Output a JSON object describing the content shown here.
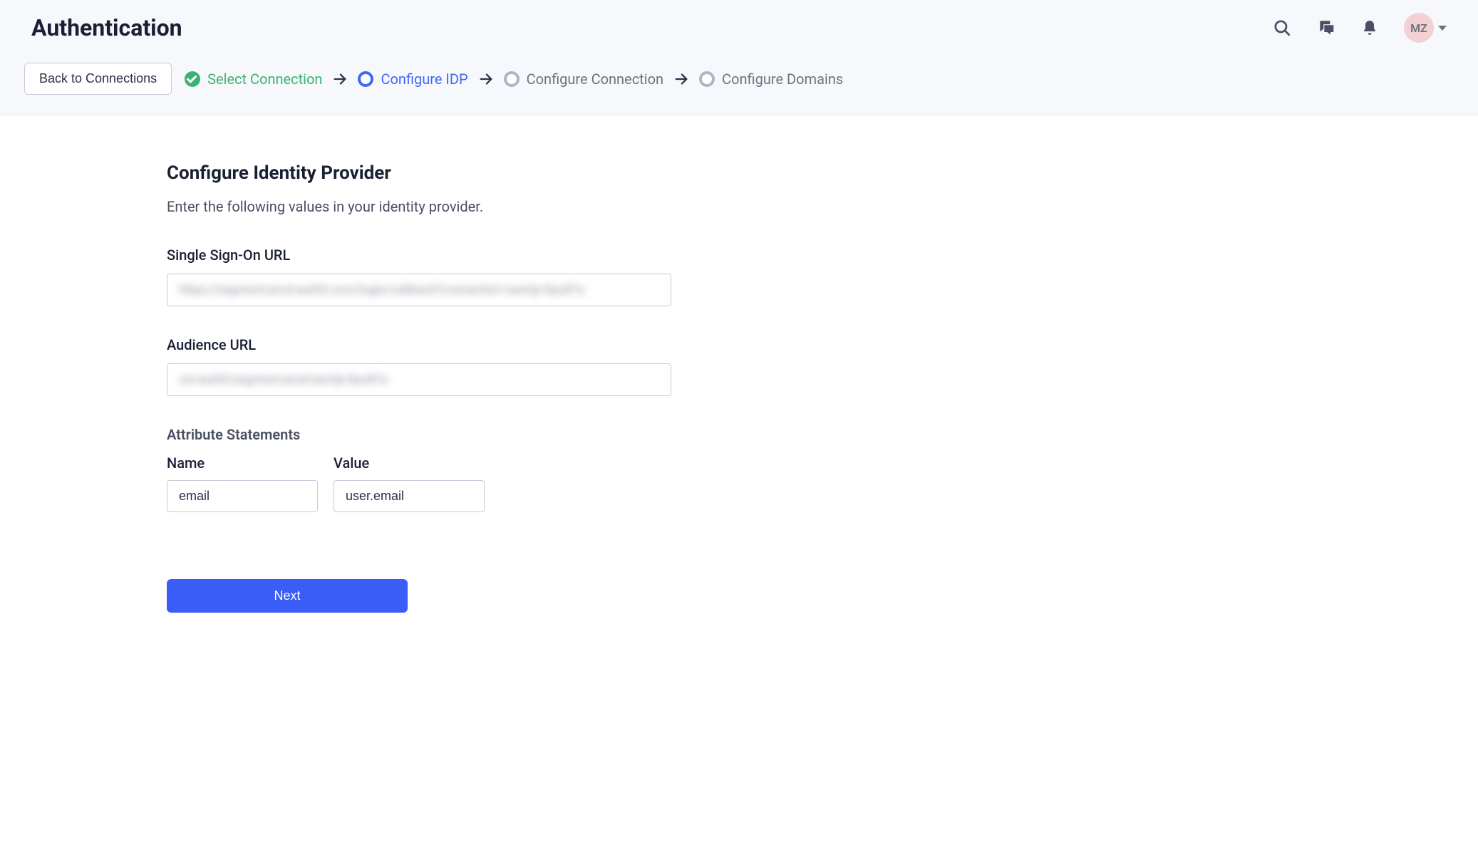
{
  "header": {
    "title": "Authentication",
    "avatar_initials": "MZ"
  },
  "stepper": {
    "back_label": "Back to Connections",
    "steps": [
      {
        "label": "Select Connection",
        "state": "done"
      },
      {
        "label": "Configure IDP",
        "state": "active"
      },
      {
        "label": "Configure Connection",
        "state": "pending"
      },
      {
        "label": "Configure Domains",
        "state": "pending"
      }
    ]
  },
  "main": {
    "title": "Configure Identity Provider",
    "description": "Enter the following values in your identity provider.",
    "sso_label": "Single Sign-On URL",
    "sso_value": "https://segment-prod.auth0.com/login/callback?connection=samlp-0pu87u",
    "audience_label": "Audience URL",
    "audience_value": "urn:auth0:segment-prod:samlp-0pu87u",
    "attr_section_label": "Attribute Statements",
    "attr_name_header": "Name",
    "attr_value_header": "Value",
    "attr_name": "email",
    "attr_value": "user.email",
    "next_label": "Next"
  }
}
